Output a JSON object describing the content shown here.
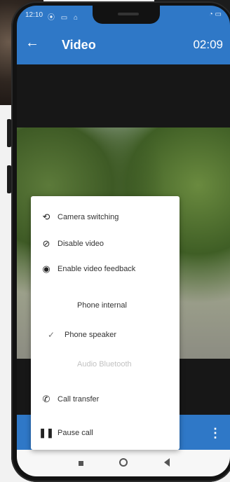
{
  "statusbar": {
    "time": "12:10",
    "icons_left": "⦿ ▭ ⌂",
    "icons_right": "◔ ▭"
  },
  "appbar": {
    "title": "Video",
    "timer": "02:09"
  },
  "menu": {
    "items": [
      {
        "label": "Camera switching",
        "icon": "camera-switch-icon"
      },
      {
        "label": "Disable video",
        "icon": "video-off-icon"
      },
      {
        "label": "Enable video feedback",
        "icon": "eye-icon"
      },
      {
        "label": "Phone internal",
        "icon": ""
      },
      {
        "label": "Phone speaker",
        "icon": "check-icon",
        "selected": true
      },
      {
        "label": "Audio Bluetooth",
        "icon": "",
        "disabled": true
      },
      {
        "label": "Call transfer",
        "icon": "phone-transfer-icon"
      },
      {
        "label": "Pause call",
        "icon": "pause-icon"
      }
    ]
  },
  "colors": {
    "accent": "#2f78c7"
  }
}
